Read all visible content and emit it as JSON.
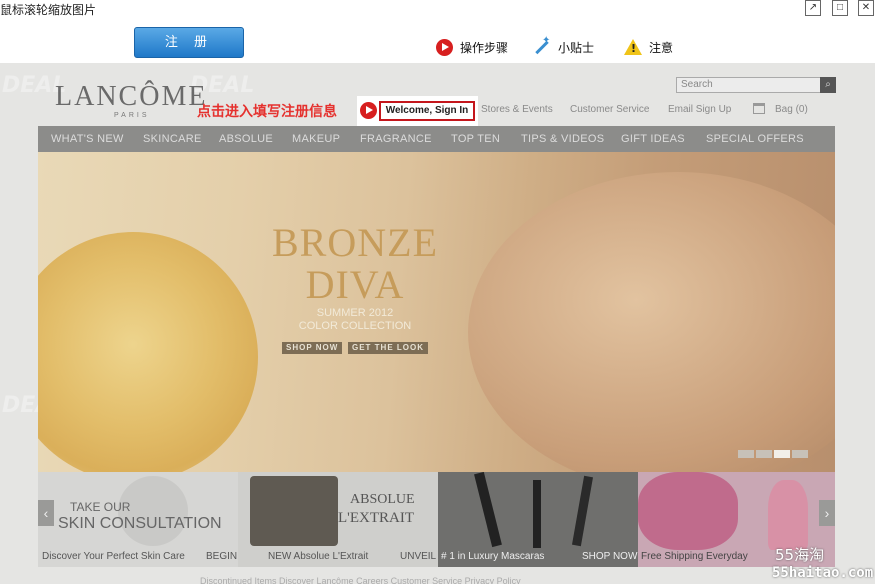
{
  "window": {
    "title": "鼠标滚轮缩放图片",
    "buttons": {
      "restore": "↗",
      "maximize": "□",
      "close": "✕"
    }
  },
  "toolbar": {
    "register_label": "注 册",
    "items": [
      {
        "icon": "play-icon",
        "label": "操作步骤"
      },
      {
        "icon": "wand-icon",
        "label": "小贴士"
      },
      {
        "icon": "warning-icon",
        "label": "注意"
      }
    ]
  },
  "site": {
    "logo": "LANCÔME",
    "logo_sub": "PARIS",
    "callout": "点击进入填写注册信息",
    "signin": "Welcome, Sign In",
    "top_links": [
      "Stores & Events",
      "Customer Service",
      "Email Sign Up",
      "Bag (0)"
    ],
    "search_placeholder": "Search",
    "nav": [
      "WHAT'S NEW",
      "SKINCARE",
      "ABSOLUE",
      "MAKEUP",
      "FRAGRANCE",
      "TOP TEN",
      "TIPS & VIDEOS",
      "GIFT IDEAS",
      "SPECIAL OFFERS"
    ],
    "hero": {
      "title_line1": "BRONZE",
      "title_line2": "DIVA",
      "subtitle_line1": "SUMMER 2012",
      "subtitle_line2": "COLOR COLLECTION",
      "shop_now": "SHOP NOW",
      "get_look": "GET THE LOOK"
    },
    "promos": [
      {
        "headline1": "TAKE OUR",
        "headline2": "SKIN CONSULTATION",
        "caption": "Discover Your Perfect Skin Care",
        "action": "BEGIN"
      },
      {
        "headline1": "ABSOLUE",
        "headline2": "L'EXTRAIT",
        "caption": "NEW Absolue L'Extrait",
        "action": "UNVEIL"
      },
      {
        "caption": "# 1 in Luxury Mascaras",
        "action": "SHOP NOW"
      },
      {
        "caption": "Free Shipping Everyday"
      }
    ],
    "footer_links": "Discontinued Items   Discover Lancôme   Careers   Customer Service   Privacy Policy"
  },
  "watermark": {
    "text": "DEAL 派",
    "brand": "55海淘",
    "site": "55haitao.com"
  },
  "colors": {
    "accent_red": "#c4161c",
    "register_blue": "#1f78c8",
    "nav_gray": "#8c8c8a"
  }
}
